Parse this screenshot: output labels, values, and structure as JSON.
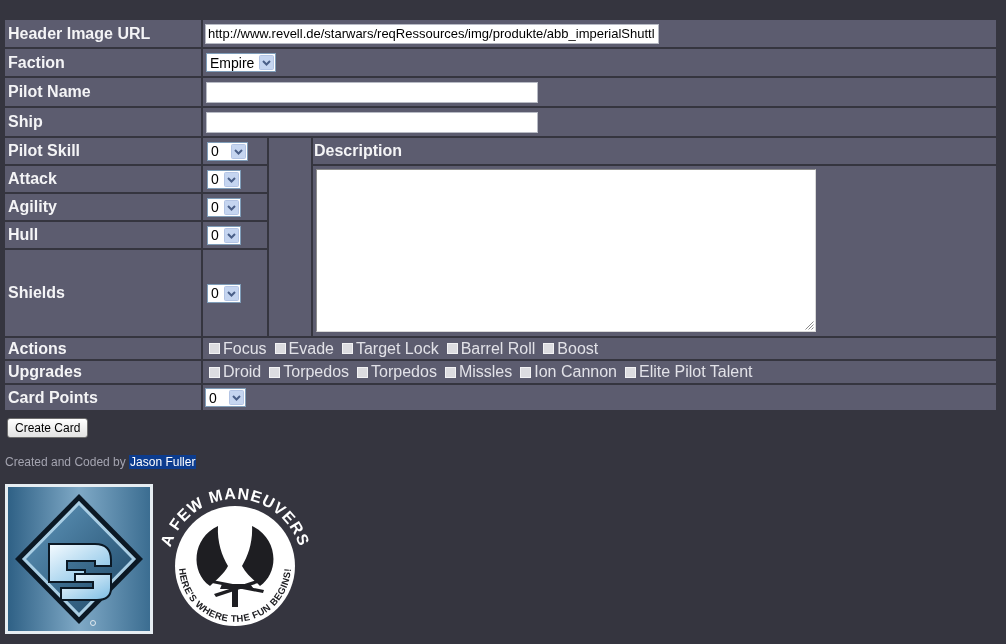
{
  "form": {
    "rows": [
      {
        "kind": "text",
        "label": "Header Image URL",
        "value": "http://www.revell.de/starwars/reqRessources/img/produkte/abb_imperialShuttl"
      },
      {
        "kind": "select",
        "label": "Faction",
        "value": "Empire"
      },
      {
        "kind": "text",
        "label": "Pilot Name"
      },
      {
        "kind": "text",
        "label": "Ship"
      }
    ],
    "stats": [
      {
        "label": "Pilot Skill",
        "value": "0"
      },
      {
        "label": "Attack",
        "value": "0"
      },
      {
        "label": "Agility",
        "value": "0"
      },
      {
        "label": "Hull",
        "value": "0"
      },
      {
        "label": "Shields",
        "value": "0"
      }
    ],
    "description": {
      "label": "Description"
    },
    "option_groups": [
      {
        "label": "Actions",
        "options": [
          {
            "label": "Focus",
            "checked": false
          },
          {
            "label": "Evade",
            "checked": false
          },
          {
            "label": "Target Lock",
            "checked": false
          },
          {
            "label": "Barrel Roll",
            "checked": false
          },
          {
            "label": "Boost",
            "checked": false
          }
        ]
      },
      {
        "label": "Upgrades",
        "options": [
          {
            "label": "Droid",
            "checked": false
          },
          {
            "label": "Torpedos",
            "checked": false
          },
          {
            "label": "Torpedos",
            "checked": false
          },
          {
            "label": "Missles",
            "checked": false
          },
          {
            "label": "Ion Cannon",
            "checked": false
          },
          {
            "label": "Elite Pilot Talent",
            "checked": false
          }
        ]
      }
    ],
    "card_points": {
      "label": "Card Points",
      "value": "0"
    }
  },
  "create_button": {
    "label": "Create Card"
  },
  "credit": {
    "text": "Created and Coded by",
    "author": "Jason Fuller",
    "highlighted": true
  },
  "logos": [
    {
      "kind": "diamond"
    },
    {
      "kind": "emblem",
      "title": "A FEW MANEUVERS",
      "tagline": "HERE'S WHERE THE FUN BEGINS!"
    }
  ]
}
